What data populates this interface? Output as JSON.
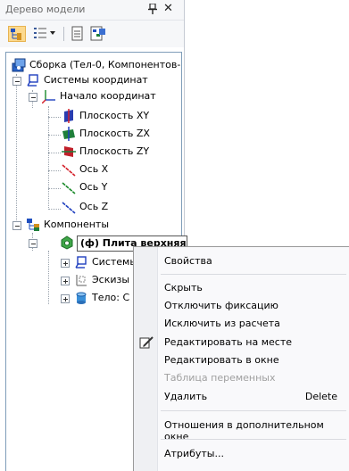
{
  "panel": {
    "title": "Дерево модели",
    "pin_icon": "pin-icon",
    "close_label": "✕"
  },
  "toolbar": {
    "buttons": [
      "tree-structure-icon",
      "view-mode-icon",
      "dropdown-arrow-icon",
      "document-icon",
      "document-tree-icon"
    ]
  },
  "tree": {
    "assembly": "Сборка (Тел-0, Компонентов-",
    "coord_systems": "Системы координат",
    "origin": "Начало координат",
    "plane_xy": "Плоскость XY",
    "plane_zx": "Плоскость ZX",
    "plane_zy": "Плоскость ZY",
    "axis_x": "Ось X",
    "axis_y": "Ось Y",
    "axis_z": "Ось Z",
    "components": "Компоненты",
    "selected_component": "(ф) Плита верхняя",
    "sub_coord": "Системы",
    "sub_sketches": "Эскизы",
    "sub_body": "Тело: С"
  },
  "context_menu": {
    "properties": "Свойства",
    "hide": "Скрыть",
    "unfix": "Отключить фиксацию",
    "exclude": "Исключить из расчета",
    "edit_in_place": "Редактировать на месте",
    "edit_in_window": "Редактировать в окне",
    "variables_table": "Таблица переменных",
    "delete": "Удалить",
    "delete_shortcut": "Delete",
    "relations": "Отношения в дополнительном окне",
    "attributes": "Атрибуты..."
  },
  "colors": {
    "accent_blue": "#1f4fbf",
    "plane_xy": "#2a3db0",
    "plane_zx": "#1e7f3a",
    "plane_zy": "#c0202a",
    "axis_x": "#d4202a",
    "axis_y": "#1a8a2a",
    "axis_z": "#1f3fbf",
    "selected_border": "#555555"
  }
}
